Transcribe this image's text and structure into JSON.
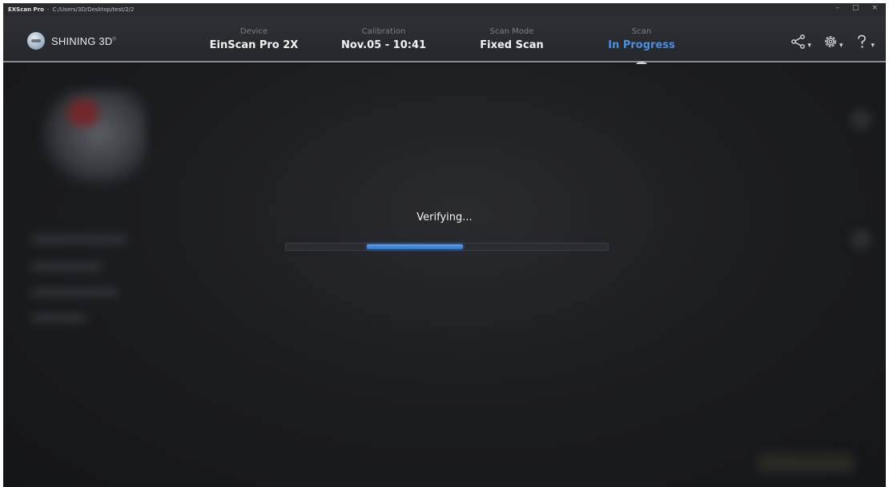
{
  "window": {
    "app_name": "EXScan Pro",
    "separator": "-",
    "path": "C:/Users/3D/Desktop/test/2/2",
    "controls": [
      "–",
      "□",
      "×"
    ]
  },
  "logo": {
    "text": "SHINING 3D",
    "mark": "®"
  },
  "steps": [
    {
      "label": "Device",
      "value": "EinScan Pro 2X",
      "state": "done"
    },
    {
      "label": "Calibration",
      "value": "Nov.05 - 10:41",
      "state": "done"
    },
    {
      "label": "Scan Mode",
      "value": "Fixed Scan",
      "state": "done"
    },
    {
      "label": "Scan",
      "value": "In Progress",
      "state": "active"
    }
  ],
  "tools": [
    {
      "icon": "share-icon",
      "caret": "▾"
    },
    {
      "icon": "gear-icon",
      "caret": "▾"
    },
    {
      "icon": "help-icon",
      "caret": "▾"
    }
  ],
  "status": {
    "message": "Verifying...",
    "progress_start": 0.25,
    "progress_end": 0.55
  },
  "colors": {
    "accent": "#4a8fe0",
    "background": "#16171a",
    "topbar": "#2b2c31"
  }
}
